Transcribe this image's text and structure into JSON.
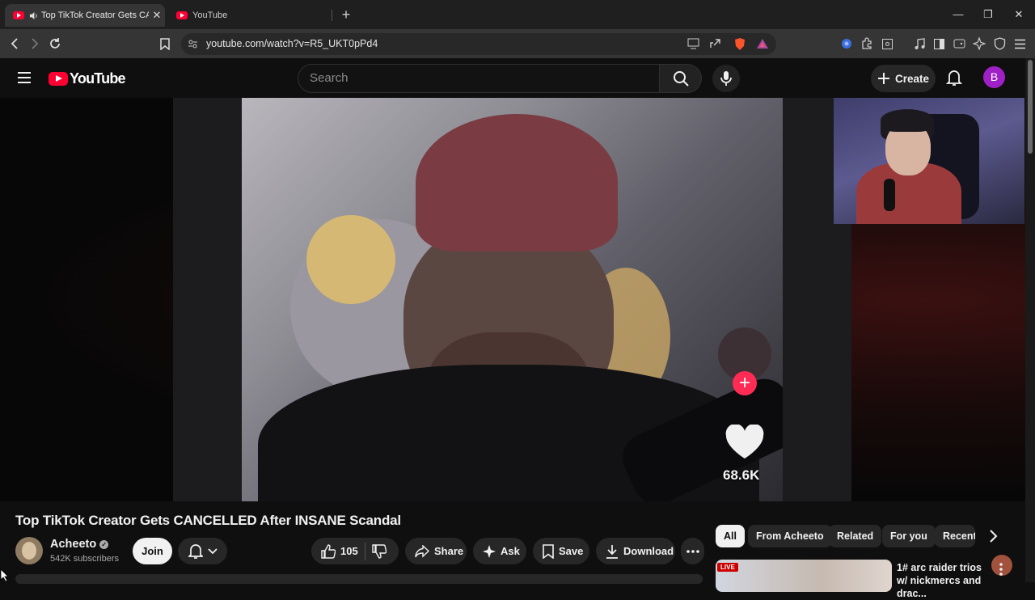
{
  "browser": {
    "tabs": [
      {
        "title": "Top TikTok Creator Gets CANCELLED After INSANE Scandal",
        "active": true
      },
      {
        "title": "YouTube",
        "active": false
      }
    ],
    "url": "youtube.com/watch?v=R5_UKT0pPd4"
  },
  "header": {
    "logo_text": "YouTube",
    "search_placeholder": "Search",
    "create_label": "Create",
    "avatar_initial": "B"
  },
  "player": {
    "tiktok_like_count": "68.6K"
  },
  "video": {
    "title": "Top TikTok Creator Gets CANCELLED After INSANE Scandal",
    "channel_name": "Acheeto",
    "subscribers": "542K subscribers",
    "join_label": "Join",
    "like_count": "105",
    "share_label": "Share",
    "ask_label": "Ask",
    "save_label": "Save",
    "download_label": "Download"
  },
  "sidebar": {
    "chips": [
      "All",
      "From Acheeto",
      "Related",
      "For you",
      "Recent"
    ],
    "selected_chip": "All",
    "recommendation": {
      "badge": "LIVE",
      "title": "1# arc raider trios w/ nickmercs and drac..."
    }
  },
  "colors": {
    "youtube_red": "#ff0033",
    "background": "#0f0f0f",
    "avatar": "#a020c8",
    "tiktok_plus": "#fe2c55"
  }
}
